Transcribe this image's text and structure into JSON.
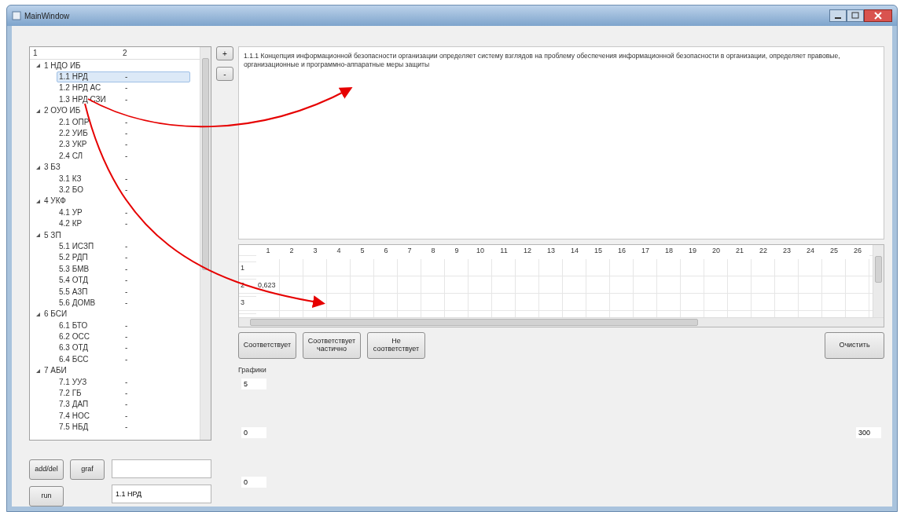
{
  "window": {
    "title": "MainWindow"
  },
  "tree": {
    "columns": [
      "1",
      "2"
    ],
    "groups": [
      {
        "label": "1 НДО ИБ",
        "expanded": true,
        "children": [
          {
            "label": "1.1 НРД",
            "value": "-",
            "selected": true
          },
          {
            "label": "1.2 НРД АС",
            "value": "-",
            "selected": false
          },
          {
            "label": "1.3 НРД СЗИ",
            "value": "-",
            "selected": false
          }
        ]
      },
      {
        "label": "2 ОУО ИБ",
        "expanded": true,
        "children": [
          {
            "label": "2.1 ОПР",
            "value": "-",
            "selected": false
          },
          {
            "label": "2.2 УИБ",
            "value": "-",
            "selected": false
          },
          {
            "label": "2.3 УКР",
            "value": "-",
            "selected": false
          },
          {
            "label": "2.4 СЛ",
            "value": "-",
            "selected": false
          }
        ]
      },
      {
        "label": "3 БЗ",
        "expanded": true,
        "children": [
          {
            "label": "3.1 КЗ",
            "value": "-",
            "selected": false
          },
          {
            "label": "3.2 БО",
            "value": "-",
            "selected": false
          }
        ]
      },
      {
        "label": "4 УКФ",
        "expanded": true,
        "children": [
          {
            "label": "4.1 УР",
            "value": "-",
            "selected": false
          },
          {
            "label": "4.2 КР",
            "value": "-",
            "selected": false
          }
        ]
      },
      {
        "label": "5 ЗП",
        "expanded": true,
        "children": [
          {
            "label": "5.1 ИСЗП",
            "value": "-",
            "selected": false
          },
          {
            "label": "5.2 РДП",
            "value": "-",
            "selected": false
          },
          {
            "label": "5.3 БМВ",
            "value": "-",
            "selected": false
          },
          {
            "label": "5.4 ОТД",
            "value": "-",
            "selected": false
          },
          {
            "label": "5.5 АЗП",
            "value": "-",
            "selected": false
          },
          {
            "label": "5.6 ДОМВ",
            "value": "-",
            "selected": false
          }
        ]
      },
      {
        "label": "6 БСИ",
        "expanded": true,
        "children": [
          {
            "label": "6.1 БТО",
            "value": "-",
            "selected": false
          },
          {
            "label": "6.2 ОСС",
            "value": "-",
            "selected": false
          },
          {
            "label": "6.3 ОТД",
            "value": "-",
            "selected": false
          },
          {
            "label": "6.4 БСС",
            "value": "-",
            "selected": false
          }
        ]
      },
      {
        "label": "7 АБИ",
        "expanded": true,
        "children": [
          {
            "label": "7.1 УУЗ",
            "value": "-",
            "selected": false
          },
          {
            "label": "7.2 ГБ",
            "value": "-",
            "selected": false
          },
          {
            "label": "7.3 ДАП",
            "value": "-",
            "selected": false
          },
          {
            "label": "7.4 НОС",
            "value": "-",
            "selected": false
          },
          {
            "label": "7.5 НБД",
            "value": "-",
            "selected": false
          }
        ]
      }
    ]
  },
  "side_buttons": [
    "+",
    "-"
  ],
  "bottom_left": {
    "buttons": [
      [
        "add/del",
        "graf"
      ],
      [
        "run"
      ]
    ],
    "fields": [
      {
        "kind": "input"
      },
      {
        "kind": "input",
        "value": "1.1 НРД"
      }
    ]
  },
  "description": "1.1.1 Концепция информационной безопасности организации определяет систему взглядов на проблему обеспечения информационной безопасности в организации, определяет правовые, организационные и программно-аппаратные меры защиты",
  "table": {
    "columns": [
      "1",
      "2",
      "3",
      "4",
      "5",
      "6",
      "7",
      "8",
      "9",
      "10",
      "11",
      "12",
      "13",
      "14",
      "15",
      "16",
      "17",
      "18",
      "19",
      "20",
      "21",
      "22",
      "23",
      "24",
      "25",
      "26"
    ],
    "rows": [
      {
        "header": "1",
        "cells": []
      },
      {
        "header": "2",
        "cells": [
          "0,623"
        ]
      },
      {
        "header": "3",
        "cells": []
      }
    ]
  },
  "answer_buttons": [
    "Соответствует",
    "Соответствует частично",
    "Не соответствует"
  ],
  "clear_button": "Очистить",
  "graphs": {
    "title": "Графики",
    "y_max": "5",
    "y_min": "0",
    "x_min": "0",
    "x_max": "300"
  },
  "annotations": [
    {
      "kind": "arrow"
    },
    {
      "kind": "arrow"
    }
  ]
}
